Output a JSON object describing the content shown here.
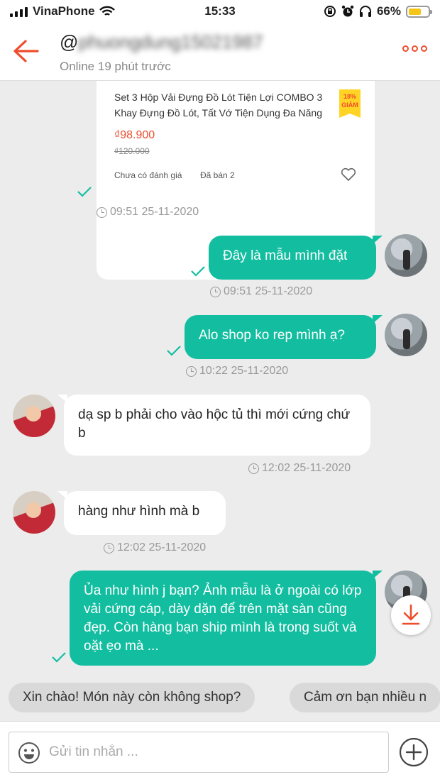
{
  "status_bar": {
    "carrier": "VinaPhone",
    "time": "15:33",
    "battery": "66%",
    "battery_level": 0.66
  },
  "header": {
    "username_prefix": "@",
    "username_blurred": "phuongdung15021987",
    "status": "Online 19 phút trước",
    "icons": [
      "back-arrow-icon",
      "more-options-icon"
    ]
  },
  "product": {
    "name": "Set 3 Hộp Vải Đựng Đồ Lót Tiện Lợi COMBO 3 Khay Đựng Đồ Lót, Tất Vớ Tiện Dụng Đa Năng",
    "badge_percent": "18%",
    "badge_label": "GIẢM",
    "price": "₫98.900",
    "old_price": "₫120.000",
    "rating": "Chưa có đánh giá",
    "sold": "Đã bán 2",
    "timestamp": "09:51 25-11-2020"
  },
  "messages": [
    {
      "sender": "me",
      "text": "Đây là mẫu mình đặt",
      "timestamp": "09:51 25-11-2020",
      "status": "sent"
    },
    {
      "sender": "me",
      "text": "Alo shop ko rep mình ạ?",
      "timestamp": "10:22 25-11-2020",
      "status": "sent"
    },
    {
      "sender": "shop",
      "text": "dạ sp b phải cho vào hộc tủ thì mới cứng chứ b",
      "timestamp": "12:02 25-11-2020"
    },
    {
      "sender": "shop",
      "text": "hàng như hình mà b",
      "timestamp": "12:02 25-11-2020"
    },
    {
      "sender": "me",
      "text": "Ủa như hình j bạn? Ảnh mẫu là ở ngoài có lớp vải cứng cáp, dày dặn để trên mặt sàn cũng đẹp. Còn hàng bạn ship mình là trong suốt và oặt ẹo mà ...",
      "status": "sent"
    }
  ],
  "quick_replies": [
    "Xin chào! Món này còn không shop?",
    "Cảm ơn bạn nhiều n"
  ],
  "input": {
    "placeholder": "Gửi tin nhắn ..."
  },
  "colors": {
    "accent": "#ee4d2d",
    "bubble_out": "#13bea0",
    "background": "#ececec"
  }
}
